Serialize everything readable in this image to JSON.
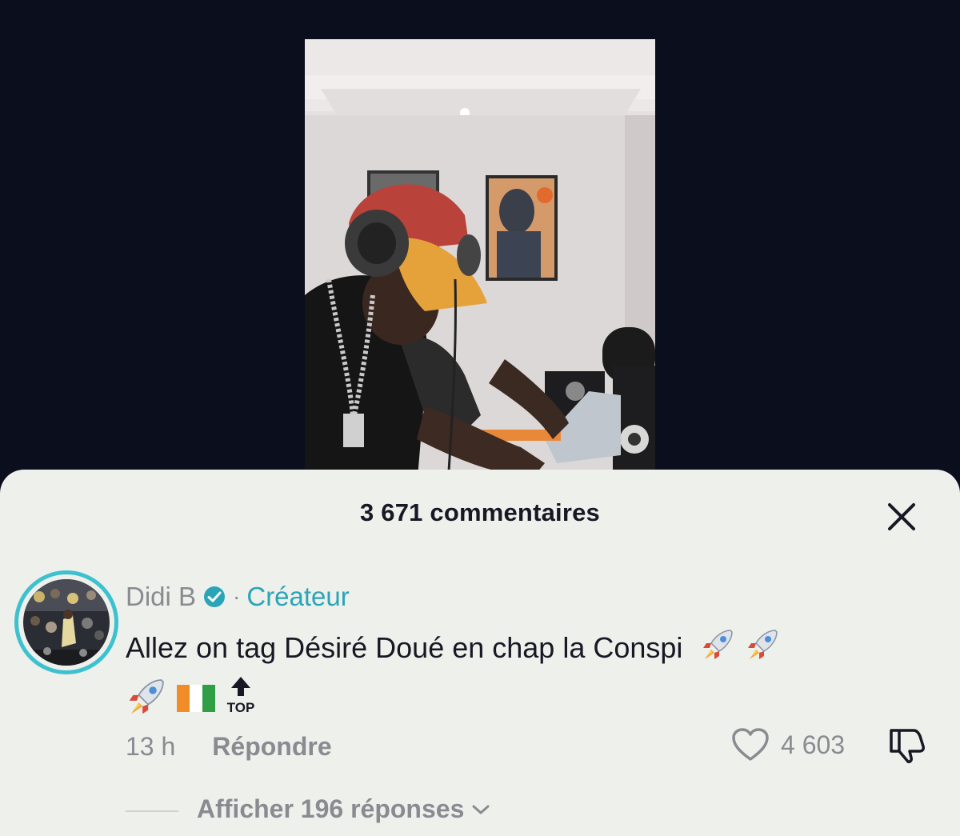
{
  "sheet": {
    "title": "3 671 commentaires",
    "close_icon": "close-icon"
  },
  "comment": {
    "author": "Didi B",
    "badge_icon": "verified-badge-icon",
    "separator": "·",
    "role": "Créateur",
    "text": "Allez on tag Désiré Doué en chap la Conspi",
    "emojis": [
      "rocket",
      "rocket",
      "rocket",
      "cote-divoire-flag",
      "top-arrow"
    ],
    "top_label": "TOP",
    "time": "13 h",
    "reply_label": "Répondre",
    "like_count": "4 603",
    "replies_label": "Afficher 196 réponses"
  },
  "colors": {
    "accent": "#2aa5b7",
    "avatar_ring": "#3ec1cf",
    "sheet_bg": "#edf0eb",
    "page_bg": "#0b0e1d",
    "muted_text": "#8a8b91"
  }
}
